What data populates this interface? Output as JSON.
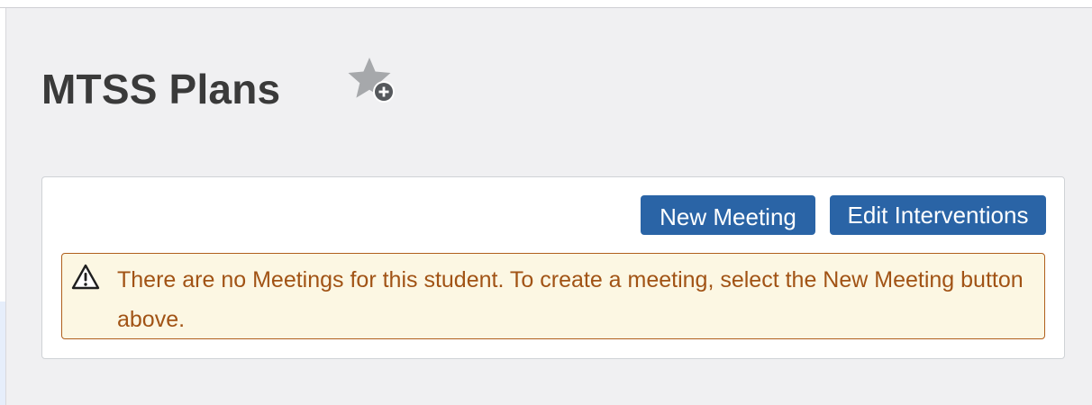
{
  "page": {
    "title": "MTSS Plans"
  },
  "favorite": {
    "icon": "star-add-icon"
  },
  "actions": {
    "new_meeting_label": "New Meeting",
    "edit_interventions_label": "Edit Interventions"
  },
  "alert": {
    "icon": "warning-icon",
    "message": "There are no Meetings for this student. To create a meeting, select the New Meeting button above."
  },
  "colors": {
    "button_primary": "#2a64a6",
    "alert_background": "#fcf7e3",
    "alert_border": "#b05f1c",
    "alert_text": "#a15315",
    "title_text": "#3a3a3a"
  }
}
